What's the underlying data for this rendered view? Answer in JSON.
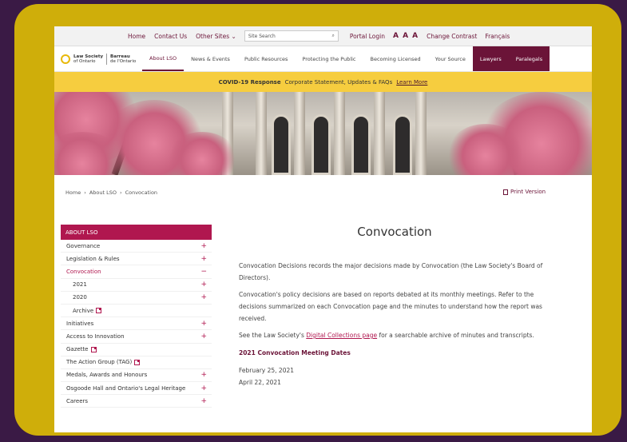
{
  "topbar": {
    "links": [
      "Home",
      "Contact Us",
      "Other Sites"
    ],
    "search_placeholder": "Site Search",
    "portal": "Portal Login",
    "text_size": "A A A",
    "contrast": "Change Contrast",
    "language": "Français"
  },
  "logo": {
    "line1": "Law Society",
    "line2": "of Ontario",
    "line3": "Barreau",
    "line4": "de l'Ontario"
  },
  "nav": {
    "items": [
      "About LSO",
      "News & Events",
      "Public Resources",
      "Protecting the Public",
      "Becoming Licensed",
      "Your Source"
    ],
    "lawyers": "Lawyers",
    "paralegals": "Paralegals"
  },
  "covid": {
    "bold": "COVID-19 Response",
    "text": "Corporate Statement, Updates & FAQs",
    "link": "Learn More"
  },
  "breadcrumb": [
    "Home",
    "About LSO",
    "Convocation"
  ],
  "print": "Print Version",
  "sidebar": {
    "header": "ABOUT LSO",
    "items": [
      {
        "label": "Governance",
        "mark": "+"
      },
      {
        "label": "Legislation & Rules",
        "mark": "+"
      },
      {
        "label": "Convocation",
        "mark": "−"
      },
      {
        "label": "2021",
        "mark": "+"
      },
      {
        "label": "2020",
        "mark": "+"
      },
      {
        "label": "Archive",
        "mark": ""
      },
      {
        "label": "Initiatives",
        "mark": "+"
      },
      {
        "label": "Access to Innovation",
        "mark": "+"
      },
      {
        "label": "Gazette",
        "mark": ""
      },
      {
        "label": "The Action Group (TAG)",
        "mark": ""
      },
      {
        "label": "Medals, Awards and Honours",
        "mark": "+"
      },
      {
        "label": "Osgoode Hall and Ontario's Legal Heritage",
        "mark": "+"
      },
      {
        "label": "Careers",
        "mark": "+"
      }
    ]
  },
  "main": {
    "title": "Convocation",
    "p1": "Convocation Decisions records the major decisions made by Convocation (the Law Society's Board of Directors).",
    "p2": "Convocation's policy decisions are based on reports debated at its monthly meetings.  Refer to the decisions summarized on each Convocation page and the minutes to understand how the report was received.",
    "p3_pre": "See the Law Society's ",
    "p3_link": "Digital Collections page",
    "p3_post": " for a searchable archive of minutes and transcripts.",
    "subtitle": "2021 Convocation Meeting Dates",
    "dates": [
      "February 25, 2021",
      "April 22, 2021"
    ]
  },
  "colors": {
    "accent": "#b0174f",
    "brand": "#6b1438",
    "banner": "#f6cd3f",
    "frame": "#cfae0a"
  }
}
